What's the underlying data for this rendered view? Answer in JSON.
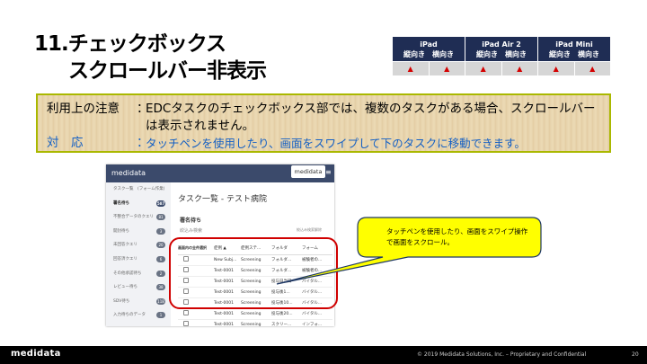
{
  "title": {
    "line1": "11.チェックボックス",
    "line2": "スクロールバー非表示"
  },
  "compat": {
    "headers": [
      {
        "name": "iPad",
        "sub": "縦向き　横向き"
      },
      {
        "name": "iPad Air 2",
        "sub": "縦向き　横向き"
      },
      {
        "name": "iPad Mini",
        "sub": "縦向き　横向き"
      }
    ],
    "marks": [
      "▲",
      "▲",
      "▲",
      "▲",
      "▲",
      "▲"
    ],
    "mark_color": "#d40000"
  },
  "note": {
    "label1": "利用上の注意",
    "colon": "：",
    "text1": "EDCタスクのチェックボックス部では、複数のタスクがある場合、スクロールバーは表示されません。",
    "label2": "対　応",
    "text2": "タッチペンを使用したり、画面をスワイプして下のタスクに移動できます。"
  },
  "screenshot": {
    "brand": "medidata",
    "brand2": "medidata",
    "menu_icon": "≡",
    "sidebar": [
      {
        "label": "タスク一覧　(フォーム作業)",
        "badge": ""
      },
      {
        "label": "署名待ち",
        "badge": "587"
      },
      {
        "label": "不整合データのクエリ",
        "badge": "81"
      },
      {
        "label": "開封待ち",
        "badge": "3"
      },
      {
        "label": "未回答クエリ",
        "badge": "20"
      },
      {
        "label": "回答済クエリ",
        "badge": "6"
      },
      {
        "label": "その他承認待ち",
        "badge": "2"
      },
      {
        "label": "レビュー待ち",
        "badge": "38"
      },
      {
        "label": "SDV待ち",
        "badge": "118"
      },
      {
        "label": "入力待ちのデータ",
        "badge": "1"
      }
    ],
    "page_title": "タスク一覧 - テスト病院",
    "section": "署名待ち",
    "filter": "絞込み検索",
    "filter_right": "絞込み検索解除",
    "columns": [
      "画面内の全件選択",
      "症例 ▲",
      "症例ステ...",
      "フォルダ",
      "フォーム"
    ],
    "rows": [
      [
        "New Subj...",
        "Screening",
        "フォルダ...",
        "被験者の..."
      ],
      [
        "Test-0001",
        "Screening",
        "フォルダ...",
        "被験者の..."
      ],
      [
        "Test-0001",
        "Screening",
        "投与日当日",
        "バイタル..."
      ],
      [
        "Test-0001",
        "Screening",
        "投与後1...",
        "バイタル..."
      ],
      [
        "Test-0001",
        "Screening",
        "投与後10...",
        "バイタル..."
      ],
      [
        "Test-0001",
        "Screening",
        "投与後20...",
        "バイタル..."
      ],
      [
        "Test-0001",
        "Screening",
        "スクリー...",
        "インフォ..."
      ]
    ]
  },
  "callout": {
    "text": "タッチペンを使用したり、画面をスワイプ操作で画面をスクロール。",
    "fill": "#ffff00"
  },
  "footer": {
    "logo": "medidata",
    "copyright": "© 2019 Medidata Solutions, Inc. – Proprietary and Confidential",
    "page": "20"
  }
}
